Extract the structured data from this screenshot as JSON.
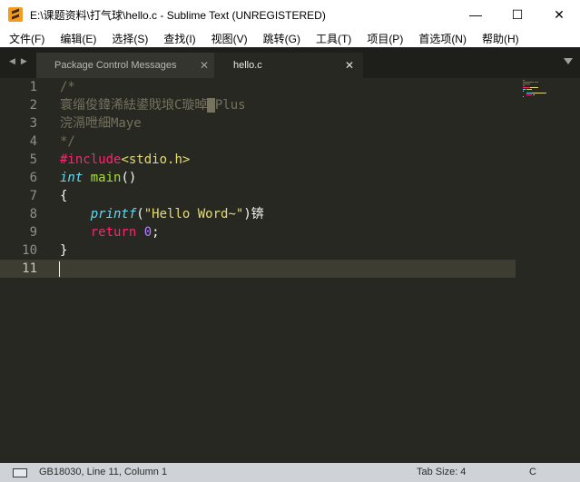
{
  "window": {
    "title": "E:\\课题资料\\打气球\\hello.c - Sublime Text (UNREGISTERED)",
    "minimize_glyph": "—",
    "maximize_glyph": "☐",
    "close_glyph": "✕"
  },
  "menu": {
    "items": [
      "文件(F)",
      "编辑(E)",
      "选择(S)",
      "查找(I)",
      "视图(V)",
      "跳转(G)",
      "工具(T)",
      "项目(P)",
      "首选项(N)",
      "帮助(H)"
    ]
  },
  "tabs": [
    {
      "label": "Package Control Messages",
      "active": false,
      "close_glyph": "✕"
    },
    {
      "label": "hello.c",
      "active": true,
      "close_glyph": "✕"
    }
  ],
  "nav": {
    "back_glyph": "◀",
    "forward_glyph": "▶"
  },
  "editor": {
    "line_numbers": [
      "1",
      "2",
      "3",
      "4",
      "5",
      "6",
      "7",
      "8",
      "9",
      "10",
      "11"
    ],
    "current_line": "11",
    "lines": [
      [
        {
          "t": "/*",
          "c": "c-comment"
        }
      ],
      [
        {
          "t": "寰缁俊鍏浠紶鍙戝埌C璇晫",
          "c": "c-comment"
        },
        {
          "t": " ",
          "c": "c-cursorblk"
        },
        {
          "t": "Plus",
          "c": "c-comment"
        }
      ],
      [
        {
          "t": "浣滆呭細Maye",
          "c": "c-comment"
        }
      ],
      [
        {
          "t": "*/",
          "c": "c-comment"
        }
      ],
      [
        {
          "t": "#include",
          "c": "c-prep"
        },
        {
          "t": "<stdio.h>",
          "c": "c-inc"
        }
      ],
      [
        {
          "t": "int",
          "c": "c-type"
        },
        {
          "t": " ",
          "c": "c-plain"
        },
        {
          "t": "main",
          "c": "c-func"
        },
        {
          "t": "()",
          "c": "c-plain"
        }
      ],
      [
        {
          "t": "{",
          "c": "c-plain"
        }
      ],
      [
        {
          "t": "    ",
          "c": "c-plain"
        },
        {
          "t": "printf",
          "c": "c-type"
        },
        {
          "t": "(",
          "c": "c-plain"
        },
        {
          "t": "\"Hello Word~\"",
          "c": "c-str"
        },
        {
          "t": ")锛",
          "c": "c-plain"
        }
      ],
      [
        {
          "t": "    ",
          "c": "c-plain"
        },
        {
          "t": "return",
          "c": "c-kw"
        },
        {
          "t": " ",
          "c": "c-plain"
        },
        {
          "t": "0",
          "c": "c-num"
        },
        {
          "t": ";",
          "c": "c-plain"
        }
      ],
      [
        {
          "t": "}",
          "c": "c-plain"
        }
      ],
      [
        {
          "t": "",
          "c": "c-plain"
        }
      ]
    ]
  },
  "statusbar": {
    "encoding_position": "GB18030, Line 11, Column 1",
    "tab_size": "Tab Size: 4",
    "syntax": "C"
  },
  "colors": {
    "editor_bg": "#272822",
    "tabbar_bg": "#1e1f1a",
    "statusbar_bg": "#cfd3d8",
    "comment": "#75715e",
    "keyword": "#f92672",
    "string": "#e6db74",
    "type": "#66d9ef",
    "function": "#a6e22e",
    "number": "#ae81ff"
  }
}
